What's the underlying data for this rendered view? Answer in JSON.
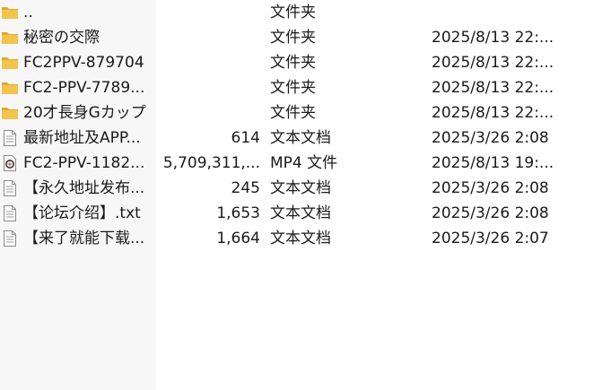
{
  "files": [
    {
      "name": "..",
      "size": "",
      "type": "文件夹",
      "date": "",
      "icon": "folder-icon"
    },
    {
      "name": "秘密の交際",
      "size": "",
      "type": "文件夹",
      "date": "2025/8/13 22:...",
      "icon": "folder-icon"
    },
    {
      "name": "FC2PPV-879704",
      "size": "",
      "type": "文件夹",
      "date": "2025/8/13 22:...",
      "icon": "folder-icon"
    },
    {
      "name": "FC2-PPV-7789...",
      "size": "",
      "type": "文件夹",
      "date": "2025/8/13 22:...",
      "icon": "folder-icon"
    },
    {
      "name": "20才長身Gカップ",
      "size": "",
      "type": "文件夹",
      "date": "2025/8/13 22:...",
      "icon": "folder-icon"
    },
    {
      "name": "最新地址及APP...",
      "size": "614",
      "type": "文本文档",
      "date": "2025/3/26 2:08",
      "icon": "text-file-icon"
    },
    {
      "name": "FC2-PPV-1182...",
      "size": "5,709,311,...",
      "type": "MP4 文件",
      "date": "2025/8/13 19:...",
      "icon": "video-file-icon"
    },
    {
      "name": "【永久地址发布...",
      "size": "245",
      "type": "文本文档",
      "date": "2025/3/26 2:08",
      "icon": "text-file-icon"
    },
    {
      "name": "【论坛介绍】.txt",
      "size": "1,653",
      "type": "文本文档",
      "date": "2025/3/26 2:08",
      "icon": "text-file-icon"
    },
    {
      "name": "【来了就能下载...",
      "size": "1,664",
      "type": "文本文档",
      "date": "2025/3/26 2:07",
      "icon": "text-file-icon"
    }
  ],
  "colors": {
    "folder": "#f3c44c",
    "folder_dark": "#e0a92a",
    "name_column_bg": "#f7f7f7"
  }
}
